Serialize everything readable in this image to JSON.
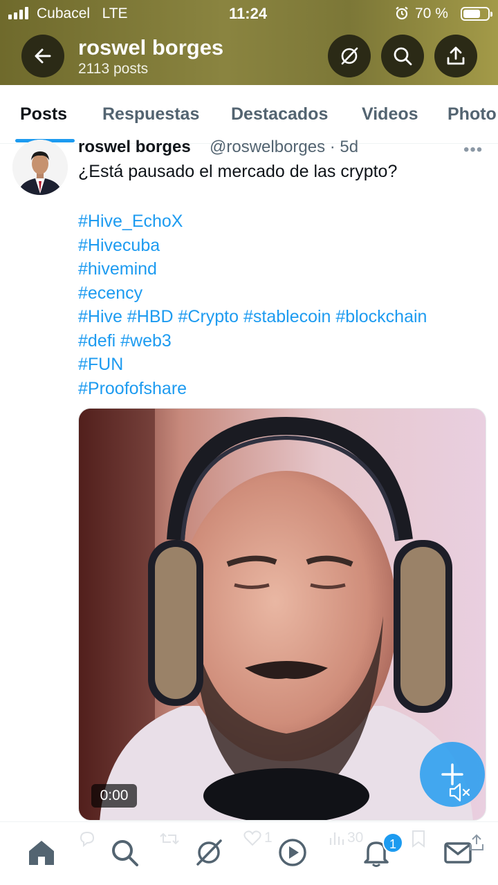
{
  "status_bar": {
    "carrier": "Cubacel",
    "network": "LTE",
    "time": "11:24",
    "battery_percent": "70 %",
    "battery_level": 0.7
  },
  "header": {
    "name": "roswel borges",
    "post_count": "2113 posts"
  },
  "tabs": [
    {
      "label": "Posts",
      "active": true
    },
    {
      "label": "Respuestas",
      "active": false
    },
    {
      "label": "Destacados",
      "active": false
    },
    {
      "label": "Videos",
      "active": false
    },
    {
      "label": "Photo",
      "active": false
    }
  ],
  "post": {
    "author_name": "roswel borges",
    "handle_time": "@roswelborges · 5d",
    "text": "¿Está pausado el mercado de las crypto?",
    "hashtag_lines": [
      "#Hive_EchoX",
      "#Hivecuba",
      "#hivemind",
      "#ecency",
      "#Hive #HBD #Crypto #stablecoin #blockchain",
      "#defi #web3",
      "#FUN",
      "#Proofofshare"
    ],
    "video": {
      "timestamp": "0:00",
      "muted": true
    },
    "actions": {
      "likes": "1",
      "views": "30"
    }
  },
  "bottom_nav": {
    "notifications_badge": "1"
  },
  "colors": {
    "accent": "#1d9bf0",
    "header_bg": "#7c7737",
    "muted_text": "#536471"
  },
  "icons": {
    "header": [
      "back-arrow-icon",
      "grok-icon",
      "search-icon",
      "share-icon"
    ],
    "nav": [
      "home-icon",
      "search-icon",
      "grok-icon",
      "play-icon",
      "bell-icon",
      "mail-icon"
    ]
  }
}
